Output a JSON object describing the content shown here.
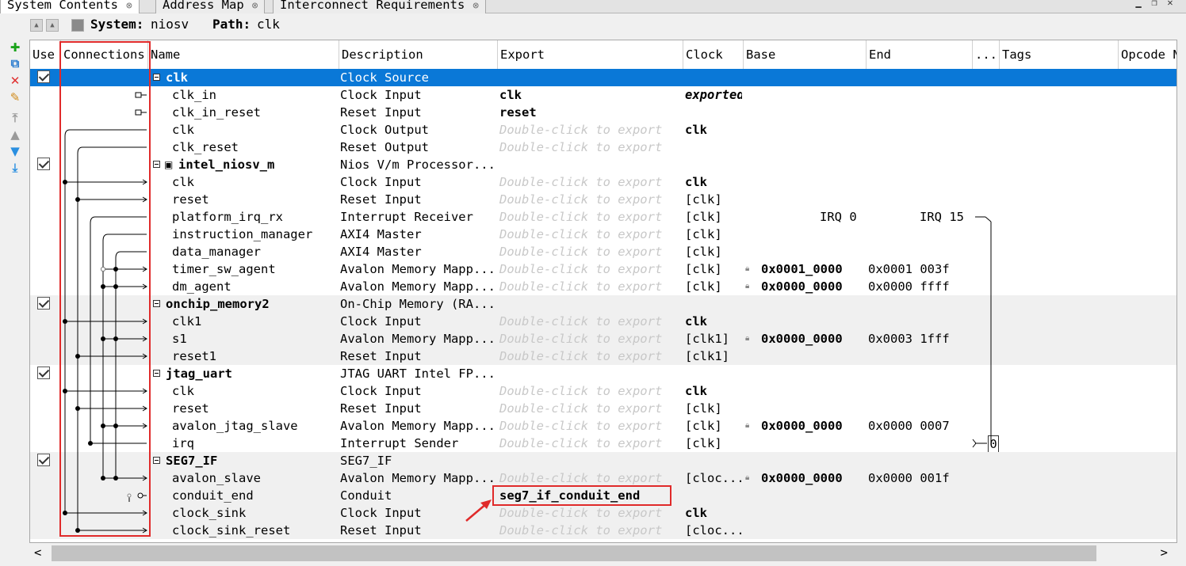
{
  "tabs": [
    {
      "label": "System Contents",
      "close": "⊗"
    },
    {
      "label": "Address Map",
      "close": "⊗"
    },
    {
      "label": "Interconnect Requirements",
      "close": "⊗"
    }
  ],
  "system": {
    "system_label": "System:",
    "system_value": "niosv",
    "path_label": "Path:",
    "path_value": "clk"
  },
  "columns": [
    "Use",
    "Connections",
    "Name",
    "Description",
    "Export",
    "Clock",
    "Base",
    "End",
    "...",
    "Tags",
    "Opcode N"
  ],
  "rows": [
    {
      "name": "clk",
      "desc": "Clock Source",
      "export": "",
      "clock": "",
      "base": "",
      "end": "",
      "module": true,
      "selected": true,
      "use": true
    },
    {
      "name": "clk_in",
      "desc": "Clock Input",
      "export": "clk",
      "clock": "exported",
      "base": "",
      "end": ""
    },
    {
      "name": "clk_in_reset",
      "desc": "Reset Input",
      "export": "reset",
      "clock": "",
      "base": "",
      "end": ""
    },
    {
      "name": "clk",
      "desc": "Clock Output",
      "export": "Double-click to export",
      "clock": "clk",
      "base": "",
      "end": ""
    },
    {
      "name": "clk_reset",
      "desc": "Reset Output",
      "export": "Double-click to export",
      "clock": "",
      "base": "",
      "end": ""
    },
    {
      "name": "intel_niosv_m",
      "desc": "Nios V/m Processor...",
      "export": "",
      "clock": "",
      "base": "",
      "end": "",
      "module": true,
      "use": true
    },
    {
      "name": "clk",
      "desc": "Clock Input",
      "export": "Double-click to export",
      "clock": "clk",
      "base": "",
      "end": ""
    },
    {
      "name": "reset",
      "desc": "Reset Input",
      "export": "Double-click to export",
      "clock": "[clk]",
      "base": "",
      "end": ""
    },
    {
      "name": "platform_irq_rx",
      "desc": "Interrupt Receiver",
      "export": "Double-click to export",
      "clock": "[clk]",
      "base": "IRQ 0",
      "end": "IRQ 15"
    },
    {
      "name": "instruction_manager",
      "desc": "AXI4 Master",
      "export": "Double-click to export",
      "clock": "[clk]",
      "base": "",
      "end": ""
    },
    {
      "name": "data_manager",
      "desc": "AXI4 Master",
      "export": "Double-click to export",
      "clock": "[clk]",
      "base": "",
      "end": ""
    },
    {
      "name": "timer_sw_agent",
      "desc": "Avalon Memory Mapp...",
      "export": "Double-click to export",
      "clock": "[clk]",
      "base": "0x0001_0000",
      "end": "0x0001 003f"
    },
    {
      "name": "dm_agent",
      "desc": "Avalon Memory Mapp...",
      "export": "Double-click to export",
      "clock": "[clk]",
      "base": "0x0000_0000",
      "end": "0x0000 ffff"
    },
    {
      "name": "onchip_memory2",
      "desc": "On-Chip Memory (RA...",
      "export": "",
      "clock": "",
      "base": "",
      "end": "",
      "module": true,
      "use": true
    },
    {
      "name": "clk1",
      "desc": "Clock Input",
      "export": "Double-click to export",
      "clock": "clk",
      "base": "",
      "end": ""
    },
    {
      "name": "s1",
      "desc": "Avalon Memory Mapp...",
      "export": "Double-click to export",
      "clock": "[clk1]",
      "base": "0x0000_0000",
      "end": "0x0003 1fff"
    },
    {
      "name": "reset1",
      "desc": "Reset Input",
      "export": "Double-click to export",
      "clock": "[clk1]",
      "base": "",
      "end": ""
    },
    {
      "name": "jtag_uart",
      "desc": "JTAG UART Intel FP...",
      "export": "",
      "clock": "",
      "base": "",
      "end": "",
      "module": true,
      "use": true
    },
    {
      "name": "clk",
      "desc": "Clock Input",
      "export": "Double-click to export",
      "clock": "clk",
      "base": "",
      "end": ""
    },
    {
      "name": "reset",
      "desc": "Reset Input",
      "export": "Double-click to export",
      "clock": "[clk]",
      "base": "",
      "end": ""
    },
    {
      "name": "avalon_jtag_slave",
      "desc": "Avalon Memory Mapp...",
      "export": "Double-click to export",
      "clock": "[clk]",
      "base": "0x0000_0000",
      "end": "0x0000 0007"
    },
    {
      "name": "irq",
      "desc": "Interrupt Sender",
      "export": "Double-click to export",
      "clock": "[clk]",
      "base": "",
      "end": "",
      "irq": "0"
    },
    {
      "name": "SEG7_IF",
      "desc": "SEG7_IF",
      "export": "",
      "clock": "",
      "base": "",
      "end": "",
      "module": true,
      "use": true
    },
    {
      "name": "avalon_slave",
      "desc": "Avalon Memory Mapp...",
      "export": "Double-click to export",
      "clock": "[cloc...",
      "base": "0x0000_0000",
      "end": "0x0000 001f"
    },
    {
      "name": "conduit_end",
      "desc": "Conduit",
      "export": "seg7_if_conduit_end",
      "clock": "",
      "base": "",
      "end": ""
    },
    {
      "name": "clock_sink",
      "desc": "Clock Input",
      "export": "Double-click to export",
      "clock": "clk",
      "base": "",
      "end": ""
    },
    {
      "name": "clock_sink_reset",
      "desc": "Reset Input",
      "export": "Double-click to export",
      "clock": "[cloc...",
      "base": "",
      "end": ""
    }
  ],
  "scroll": {
    "left": "<",
    "right": ">"
  },
  "colors": {
    "selection": "#0a78d7",
    "highlight": "#e02a2a"
  }
}
